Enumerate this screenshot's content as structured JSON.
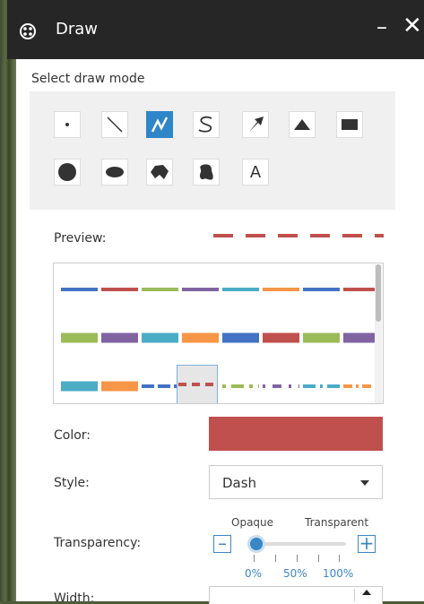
{
  "window": {
    "title": "Draw",
    "minimize_icon": "minimize-icon",
    "close_icon": "close-icon"
  },
  "draw_mode": {
    "label": "Select draw mode",
    "active_mode": "polyline",
    "modes": [
      {
        "name": "point",
        "icon": "point-icon"
      },
      {
        "name": "line",
        "icon": "line-icon"
      },
      {
        "name": "polyline",
        "icon": "polyline-icon"
      },
      {
        "name": "freehand-polyline",
        "icon": "freehand-polyline-icon"
      },
      {
        "name": "arrow",
        "icon": "arrow-icon"
      },
      {
        "name": "triangle",
        "icon": "triangle-icon"
      },
      {
        "name": "rectangle",
        "icon": "rectangle-icon"
      },
      {
        "name": "circle",
        "icon": "circle-icon"
      },
      {
        "name": "ellipse",
        "icon": "ellipse-icon"
      },
      {
        "name": "polygon",
        "icon": "polygon-icon"
      },
      {
        "name": "freehand-polygon",
        "icon": "freehand-polygon-icon"
      },
      {
        "name": "text",
        "icon": "text-icon",
        "glyph": "A"
      }
    ]
  },
  "preview": {
    "label": "Preview:",
    "color": "#c0504d"
  },
  "style_swatches": {
    "rows": [
      [
        "#4472c4",
        "#c0504d",
        "#9bbb59",
        "#8064a2",
        "#4bacc6",
        "#f79646",
        "#4472c4",
        "#c0504d"
      ],
      [
        "#9bbb59",
        "#8064a2",
        "#4bacc6",
        "#f79646",
        "#4472c4",
        "#c0504d",
        "#9bbb59",
        "#8064a2"
      ],
      [
        "#4bacc6",
        "#f79646",
        "#4472c4",
        "#c0504d",
        "#9bbb59",
        "#8064a2",
        "#4bacc6",
        "#f79646"
      ]
    ]
  },
  "color": {
    "label": "Color:",
    "value": "#c0504d"
  },
  "style": {
    "label": "Style:",
    "value": "Dash"
  },
  "transparency": {
    "label": "Transparency:",
    "left_label": "Opaque",
    "right_label": "Transparent",
    "value": 0,
    "ticks": [
      "0%",
      "50%",
      "100%"
    ],
    "accent": "#3a87c8"
  },
  "width": {
    "label": "Width:"
  }
}
